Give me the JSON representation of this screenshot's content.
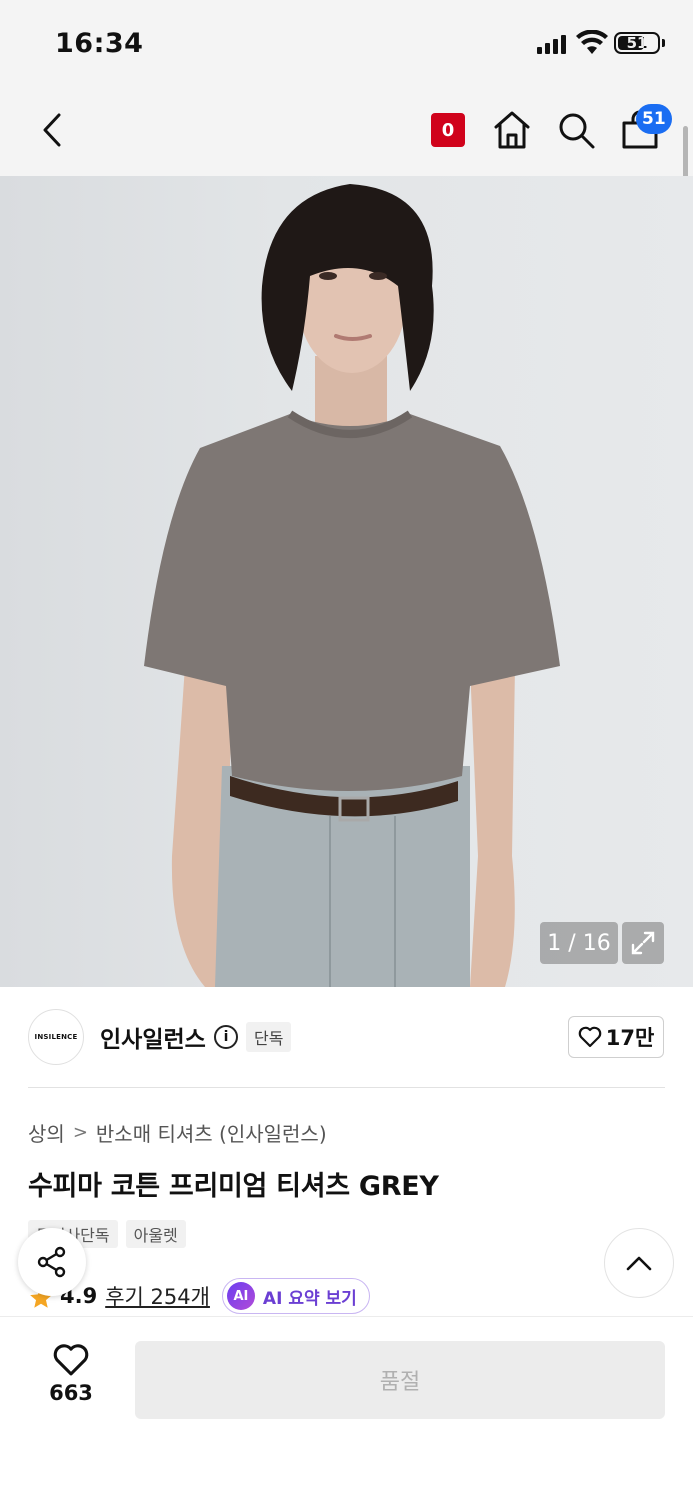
{
  "status_bar": {
    "time": "16:34",
    "battery": "51"
  },
  "nav": {
    "coupon_count": "0",
    "cart_count": "51",
    "icons": [
      "back-icon",
      "home-icon",
      "search-icon",
      "cart-icon"
    ]
  },
  "gallery": {
    "counter": "1 / 16"
  },
  "brand": {
    "logo_text": "INSILENCE",
    "name": "인사일런스",
    "info_symbol": "i",
    "badge": "단독",
    "likes": "17만"
  },
  "breadcrumb": {
    "category": "상의",
    "subcategory": "반소매 티셔츠 (인사일런스)"
  },
  "product": {
    "title": "수피마 코튼 프리미엄 티셔츠 GREY",
    "tags": [
      "무신사단독",
      "아울렛"
    ],
    "rating": "4.9",
    "reviews": "후기 254개",
    "ai_badge": "AI",
    "ai_summary": "AI 요약 보기"
  },
  "bottom": {
    "wish_count": "663",
    "buy_label": "품절"
  },
  "colors": {
    "accent_red": "#d0021b",
    "badge_blue": "#1a6df2",
    "ai_purple": "#6b3fd3",
    "star": "#f5a623"
  }
}
